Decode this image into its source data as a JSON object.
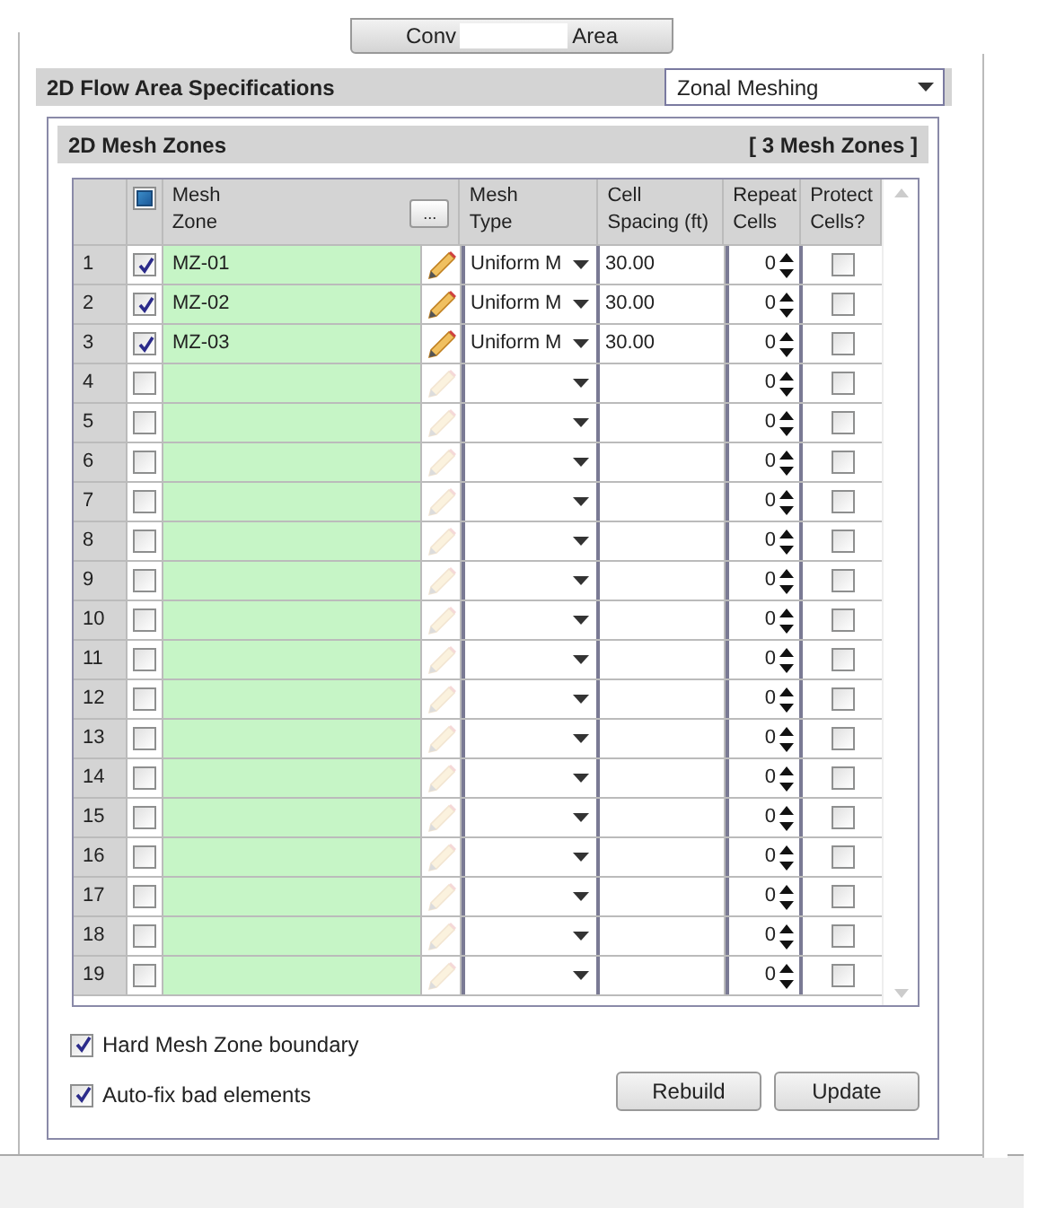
{
  "top_button": {
    "parts": [
      "Conv",
      "Area"
    ]
  },
  "specs": {
    "title": "2D Flow Area Specifications",
    "mode_dropdown": {
      "value": "Zonal Meshing"
    }
  },
  "mesh_zones": {
    "title": "2D Mesh Zones",
    "count": "[ 3 Mesh Zones ]",
    "header": {
      "all_checked": true,
      "columns": [
        "Mesh\nZone",
        "Mesh\nType",
        "Cell\nSpacing (ft)",
        "Repeat\nCells",
        "Protect\nCells?"
      ],
      "browse_button": "..."
    },
    "rows": [
      {
        "number": "1",
        "checked": true,
        "zone": "MZ-01",
        "type": "Uniform M",
        "spacing": "30.00",
        "repeat": "0",
        "protect": false
      },
      {
        "number": "2",
        "checked": true,
        "zone": "MZ-02",
        "type": "Uniform M",
        "spacing": "30.00",
        "repeat": "0",
        "protect": false
      },
      {
        "number": "3",
        "checked": true,
        "zone": "MZ-03",
        "type": "Uniform M",
        "spacing": "30.00",
        "repeat": "0",
        "protect": false
      },
      {
        "number": "4",
        "checked": false,
        "repeat": "0",
        "protect": false
      },
      {
        "number": "5",
        "checked": false,
        "repeat": "0",
        "protect": false
      },
      {
        "number": "6",
        "checked": false,
        "repeat": "0",
        "protect": false
      },
      {
        "number": "7",
        "checked": false,
        "repeat": "0",
        "protect": false
      },
      {
        "number": "8",
        "checked": false,
        "repeat": "0",
        "protect": false
      },
      {
        "number": "9",
        "checked": false,
        "repeat": "0",
        "protect": false
      },
      {
        "number": "10",
        "checked": false,
        "repeat": "0",
        "protect": false
      },
      {
        "number": "11",
        "checked": false,
        "repeat": "0",
        "protect": false
      },
      {
        "number": "12",
        "checked": false,
        "repeat": "0",
        "protect": false
      },
      {
        "number": "13",
        "checked": false,
        "repeat": "0",
        "protect": false
      },
      {
        "number": "14",
        "checked": false,
        "repeat": "0",
        "protect": false
      },
      {
        "number": "15",
        "checked": false,
        "repeat": "0",
        "protect": false
      },
      {
        "number": "16",
        "checked": false,
        "repeat": "0",
        "protect": false
      },
      {
        "number": "17",
        "checked": false,
        "repeat": "0",
        "protect": false
      },
      {
        "number": "18",
        "checked": false,
        "repeat": "0",
        "protect": false
      },
      {
        "number": "19",
        "checked": false,
        "repeat": "0",
        "protect": false
      }
    ]
  },
  "options": [
    {
      "label": "Hard Mesh Zone boundary",
      "checked": true
    },
    {
      "label": "Auto-fix bad elements",
      "checked": true
    }
  ],
  "buttons": [
    "Rebuild",
    "Update"
  ]
}
